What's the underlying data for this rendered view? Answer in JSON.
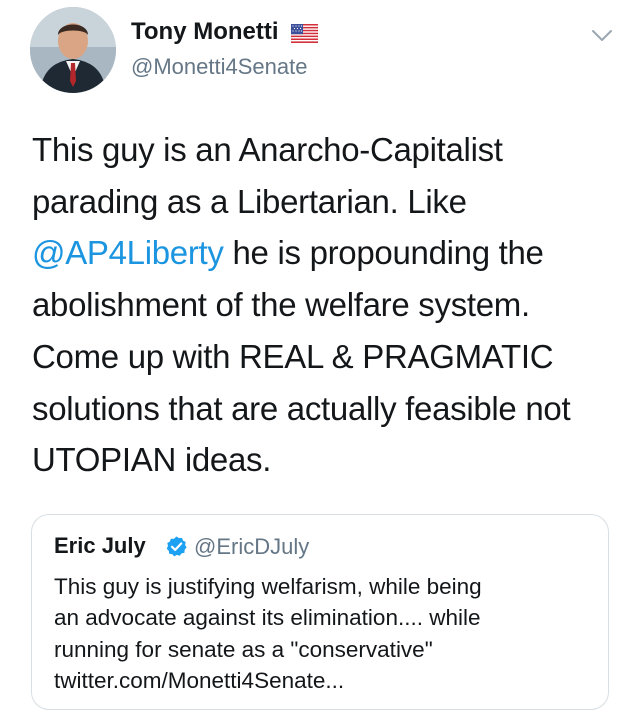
{
  "tweet": {
    "author": {
      "name": "Tony Monetti",
      "handle": "@Monetti4Senate",
      "flag_icon": "us-flag-icon"
    },
    "menu_icon": "chevron-down-icon",
    "text_lines": [
      {
        "before": "This guy is an Anarcho-Capitalist"
      },
      {
        "before": "parading as a Libertarian. Like"
      },
      {
        "mention": "@AP4Liberty",
        "after": " he is propounding the"
      },
      {
        "before": "abolishment of the welfare system."
      },
      {
        "before": "Come up with REAL & PRAGMATIC"
      },
      {
        "before": "solutions that are actually feasible not"
      },
      {
        "before": "UTOPIAN ideas."
      }
    ],
    "quoted": {
      "name": "Eric July",
      "handle": "@EricDJuly",
      "verified_icon": "verified-badge-icon",
      "text_lines": [
        "This guy is justifying welfarism, while being",
        "an advocate against its elimination.... while",
        "running for senate as a \"conservative\"",
        "twitter.com/Monetti4Senate..."
      ]
    },
    "colors": {
      "link": "#1b95e0",
      "secondary_text": "#657786",
      "border": "#d8dee3",
      "verified": "#1da1f2"
    }
  }
}
